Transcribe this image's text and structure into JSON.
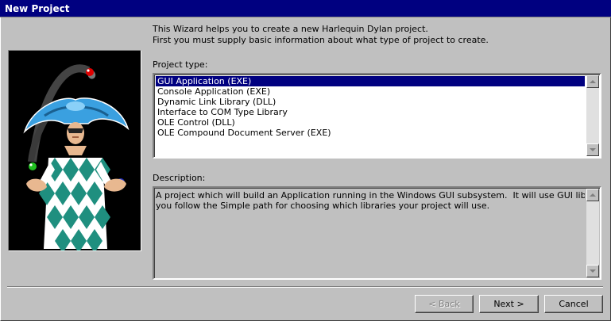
{
  "window": {
    "title": "New Project"
  },
  "intro": {
    "line1": "This Wizard helps you to create a new Harlequin Dylan project.",
    "line2": "First you must supply basic information about what type of project to create."
  },
  "project_type": {
    "label": "Project type:",
    "items": [
      "GUI Application (EXE)",
      "Console Application (EXE)",
      "Dynamic Link Library (DLL)",
      "Interface to COM Type Library",
      "OLE Control (DLL)",
      "OLE Compound Document Server (EXE)"
    ],
    "selected_index": 0
  },
  "description": {
    "label": "Description:",
    "text": "A project which will build an Application running in the Windows GUI subsystem.  It will use GUI libraries by default, if\nyou follow the Simple path for choosing which libraries your project will use."
  },
  "buttons": {
    "back": "< Back",
    "next": "Next >",
    "cancel": "Cancel"
  },
  "colors": {
    "titlebar": "#000080",
    "selection": "#000080",
    "face": "#c0c0c0",
    "picture_bg": "#000000"
  },
  "icons": {
    "scroll_up": "triangle-up",
    "scroll_down": "triangle-down"
  }
}
